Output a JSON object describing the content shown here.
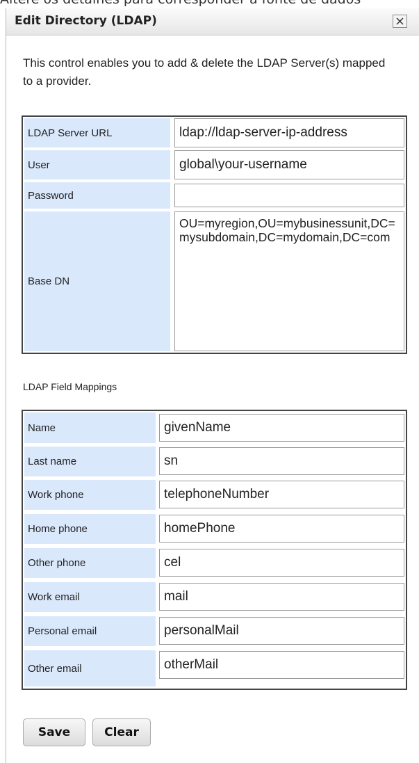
{
  "background_text": "Altere os detalhes para corresponder à fonte de dados",
  "dialog": {
    "title": "Edit Directory (LDAP)",
    "close_icon": "close-icon",
    "intro": "This control enables you to add & delete the LDAP Server(s) mapped to a provider."
  },
  "server": {
    "url_label": "LDAP Server URL",
    "url_value": "ldap://ldap-server-ip-address",
    "user_label": "User",
    "user_value": "global\\your-username",
    "password_label": "Password",
    "password_value": "",
    "basedn_label": "Base DN",
    "basedn_value": "OU=myregion,OU=mybusinessunit,DC=mysubdomain,DC=mydomain,DC=com"
  },
  "mappings": {
    "section_label": "LDAP Field Mappings",
    "rows": [
      {
        "label": "Name",
        "value": "givenName"
      },
      {
        "label": "Last name",
        "value": "sn"
      },
      {
        "label": "Work phone",
        "value": "telephoneNumber"
      },
      {
        "label": "Home phone",
        "value": "homePhone"
      },
      {
        "label": "Other phone",
        "value": "cel"
      },
      {
        "label": "Work email",
        "value": "mail"
      },
      {
        "label": "Personal email",
        "value": "personalMail"
      },
      {
        "label": "Other email",
        "value": "otherMail"
      }
    ]
  },
  "buttons": {
    "save": "Save",
    "clear": "Clear"
  },
  "colors": {
    "label_bg": "#dae8fc",
    "table_border": "#444444"
  }
}
